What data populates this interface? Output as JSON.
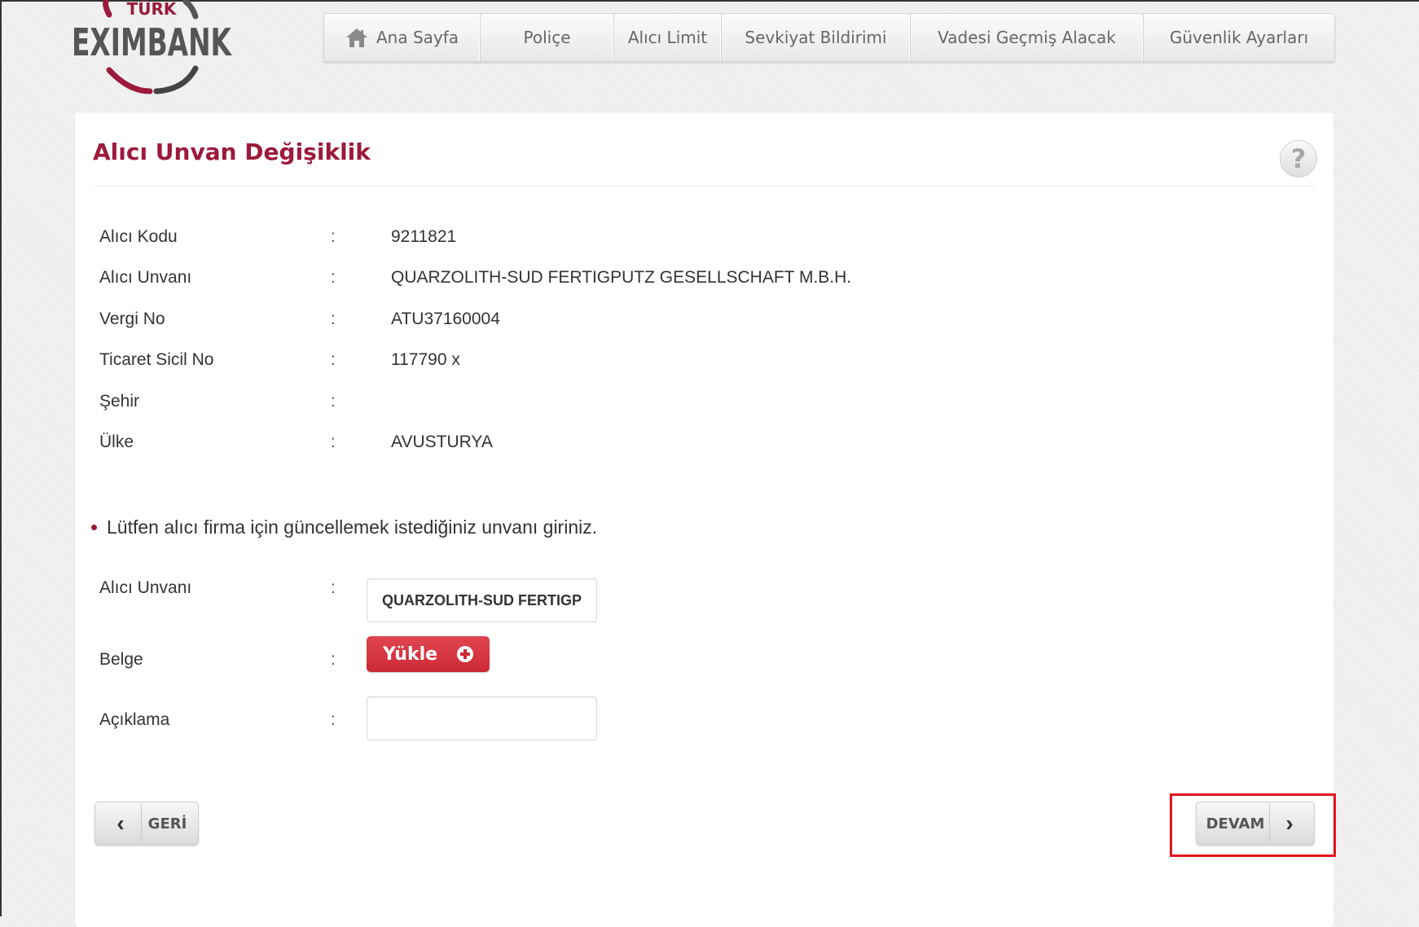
{
  "logo": {
    "top_text": "TÜRK",
    "main_text": "EXIMBANK"
  },
  "nav": {
    "items": [
      {
        "label": "Ana Sayfa",
        "icon": "home-icon"
      },
      {
        "label": "Poliçe"
      },
      {
        "label": "Alıcı Limit"
      },
      {
        "label": "Sevkiyat Bildirimi"
      },
      {
        "label": "Vadesi Geçmiş Alacak"
      },
      {
        "label": "Güvenlik Ayarları"
      }
    ]
  },
  "page": {
    "title": "Alıcı Unvan Değişiklik",
    "help_icon": "?"
  },
  "buyer": {
    "separator": ":",
    "fields": [
      {
        "label": "Alıcı Kodu",
        "value": "9211821"
      },
      {
        "label": "Alıcı Unvanı",
        "value": "QUARZOLITH-SUD FERTIGPUTZ GESELLSCHAFT M.B.H."
      },
      {
        "label": "Vergi No",
        "value": "ATU37160004"
      },
      {
        "label": "Ticaret Sicil No",
        "value": "117790 x"
      },
      {
        "label": "Şehir",
        "value": ""
      },
      {
        "label": "Ülke",
        "value": "AVUSTURYA"
      }
    ]
  },
  "form": {
    "instruction": "Lütfen alıcı firma için güncellemek istediğiniz unvanı giriniz.",
    "title_label": "Alıcı Unvanı",
    "title_value": "QUARZOLITH-SUD FERTIGPUTZ GESELLSCHAFT M.B.H.",
    "document_label": "Belge",
    "upload_label": "Yükle",
    "description_label": "Açıklama",
    "description_value": ""
  },
  "actions": {
    "back_label": "GERİ",
    "next_label": "DEVAM"
  },
  "colors": {
    "accent": "#9c1a3c",
    "upload_button": "#cc2a35",
    "highlight": "#e0141e"
  }
}
